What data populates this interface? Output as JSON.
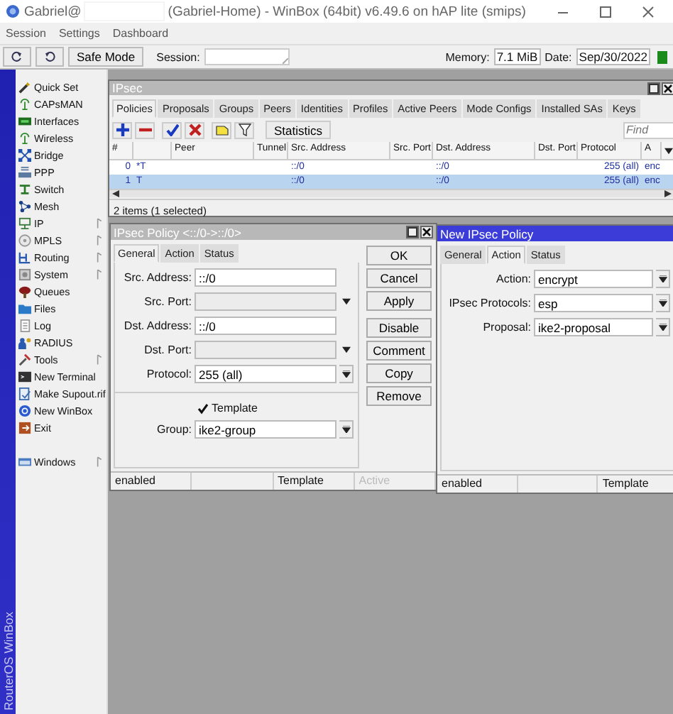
{
  "window": {
    "title_user": "Gabriel@",
    "title_rest": "(Gabriel-Home) - WinBox (64bit) v6.49.6 on hAP lite (smips)"
  },
  "menu": [
    "Session",
    "Settings",
    "Dashboard"
  ],
  "toolbar": {
    "safe_mode": "Safe Mode",
    "session_label": "Session:",
    "memory_label": "Memory:",
    "memory": "7.1 MiB",
    "date_label": "Date:",
    "date": "Sep/30/2022"
  },
  "sidebar": {
    "brand": "RouterOS WinBox",
    "items": [
      {
        "label": "Quick Set",
        "submenu": false
      },
      {
        "label": "CAPsMAN",
        "submenu": false
      },
      {
        "label": "Interfaces",
        "submenu": false
      },
      {
        "label": "Wireless",
        "submenu": false
      },
      {
        "label": "Bridge",
        "submenu": false
      },
      {
        "label": "PPP",
        "submenu": false
      },
      {
        "label": "Switch",
        "submenu": false
      },
      {
        "label": "Mesh",
        "submenu": false
      },
      {
        "label": "IP",
        "submenu": true
      },
      {
        "label": "MPLS",
        "submenu": true
      },
      {
        "label": "Routing",
        "submenu": true
      },
      {
        "label": "System",
        "submenu": true
      },
      {
        "label": "Queues",
        "submenu": false
      },
      {
        "label": "Files",
        "submenu": false
      },
      {
        "label": "Log",
        "submenu": false
      },
      {
        "label": "RADIUS",
        "submenu": false
      },
      {
        "label": "Tools",
        "submenu": true
      },
      {
        "label": "New Terminal",
        "submenu": false
      },
      {
        "label": "Make Supout.rif",
        "submenu": false
      },
      {
        "label": "New WinBox",
        "submenu": false
      },
      {
        "label": "Exit",
        "submenu": false
      }
    ],
    "bottom_items": [
      {
        "label": "Windows",
        "submenu": true
      }
    ]
  },
  "ipsec": {
    "title": "IPsec",
    "active": false,
    "tabs": [
      {
        "label": "Policies",
        "selected": true
      },
      {
        "label": "Proposals",
        "selected": false
      },
      {
        "label": "Groups",
        "selected": false
      },
      {
        "label": "Peers",
        "selected": false
      },
      {
        "label": "Identities",
        "selected": false
      },
      {
        "label": "Profiles",
        "selected": false
      },
      {
        "label": "Active Peers",
        "selected": false
      },
      {
        "label": "Mode Configs",
        "selected": false
      },
      {
        "label": "Installed SAs",
        "selected": false
      },
      {
        "label": "Keys",
        "selected": false
      }
    ],
    "statistics": "Statistics",
    "find_placeholder": "Find",
    "columns": [
      "#",
      "Peer",
      "Tunnel",
      "Src. Address",
      "Src. Port",
      "Dst. Address",
      "Dst. Port",
      "Protocol",
      "A"
    ],
    "rows": [
      {
        "number": "0",
        "flags": "*T",
        "src_address": "::/0",
        "dst_address": "::/0",
        "protocol": "255 (all)",
        "column_10": "enc",
        "selected": false
      },
      {
        "number": "1",
        "flags": "T",
        "src_address": "::/0",
        "dst_address": "::/0",
        "protocol": "255 (all)",
        "column_10": "enc",
        "selected": true
      }
    ],
    "status": "2 items (1 selected)"
  },
  "policy": {
    "title": "IPsec Policy <::/0->::/0>",
    "active": false,
    "tabs": [
      {
        "label": "General",
        "selected": true
      },
      {
        "label": "Action",
        "selected": false
      },
      {
        "label": "Status",
        "selected": false
      }
    ],
    "fields": [
      {
        "label": "Src. Address:",
        "kind": "text",
        "value": "::/0"
      },
      {
        "label": "Src. Port:",
        "kind": "dropdown"
      },
      {
        "label": "Dst. Address:",
        "kind": "text",
        "value": "::/0"
      },
      {
        "label": "Dst. Port:",
        "kind": "dropdown"
      },
      {
        "label": "Protocol:",
        "kind": "combo",
        "value": "255 (all)"
      },
      {
        "label": "Template",
        "kind": "checkbox",
        "checked": true
      },
      {
        "label": "Group:",
        "kind": "combo",
        "value": "ike2-group"
      }
    ],
    "buttons": [
      "OK",
      "Cancel",
      "Apply",
      "Disable",
      "Comment",
      "Copy",
      "Remove"
    ],
    "status": [
      {
        "text": "enabled",
        "disabled": false
      },
      {
        "text": "Template",
        "disabled": false
      },
      {
        "text": "Active",
        "disabled": true
      }
    ]
  },
  "new_policy": {
    "title": "New IPsec Policy",
    "active": true,
    "tabs": [
      {
        "label": "General",
        "selected": false
      },
      {
        "label": "Action",
        "selected": true
      },
      {
        "label": "Status",
        "selected": false
      }
    ],
    "fields": [
      {
        "label": "Action:",
        "kind": "combo",
        "value": "encrypt"
      },
      {
        "label": "IPsec Protocols:",
        "kind": "combo",
        "value": "esp"
      },
      {
        "label": "Proposal:",
        "kind": "combo",
        "value": "ike2-proposal"
      }
    ],
    "status": [
      {
        "text": "enabled",
        "disabled": false
      },
      {
        "text": "Template",
        "disabled": false
      }
    ]
  }
}
